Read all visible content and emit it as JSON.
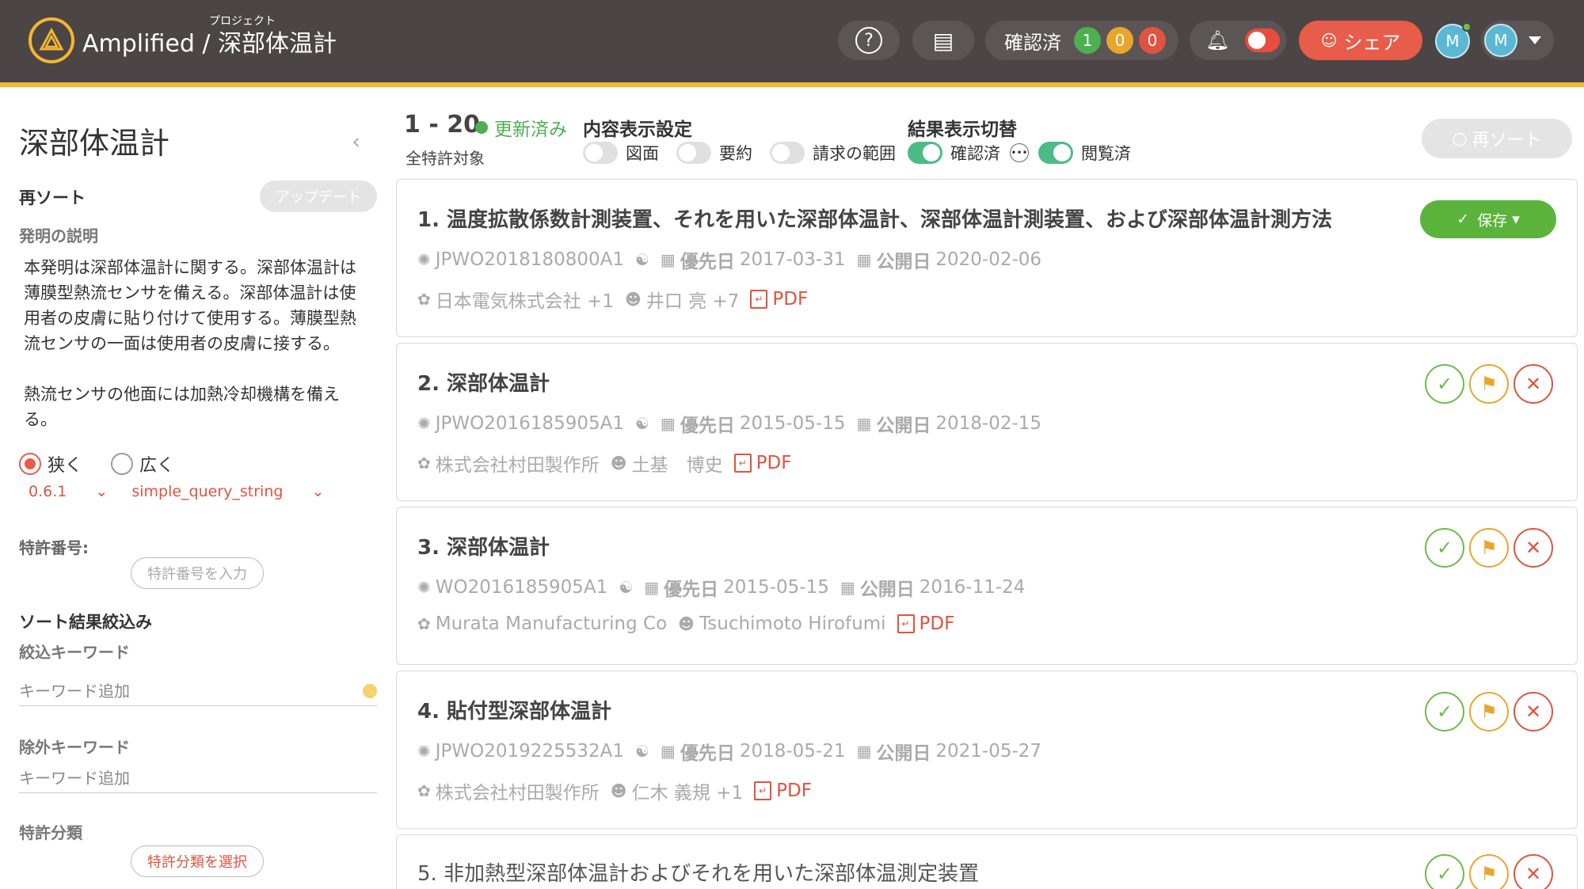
{
  "header": {
    "app_name": "Amplified",
    "separator": "/",
    "project_label": "プロジェクト",
    "project_name": "深部体温計",
    "help_icon": "?",
    "confirm_label": "確認済",
    "badges": [
      {
        "value": "1",
        "color": "#4caf50"
      },
      {
        "value": "0",
        "color": "#e8a62c"
      },
      {
        "value": "0",
        "color": "#e05340"
      }
    ],
    "share_label": "シェア",
    "avatar_letter": "M"
  },
  "sidebar": {
    "title": "深部体温計",
    "resort_label": "再ソート",
    "update_button": "アップデート",
    "description_label": "発明の説明",
    "description_p1": "本発明は深部体温計に関する。深部体温計は薄膜型熱流センサを備える。深部体温計は使用者の皮膚に貼り付けて使用する。薄膜型熱流センサの一面は使用者の皮膚に接する。",
    "description_p2": "熱流センサの他面には加熱冷却機構を備える。",
    "radio_narrow": "狭く",
    "radio_wide": "広く",
    "version": "0.6.1",
    "query_type": "simple_query_string",
    "patent_number_label": "特許番号:",
    "patent_number_button": "特許番号を入力",
    "filter_label": "ソート結果絞込み",
    "filter_keyword_label": "絞込キーワード",
    "filter_keyword_placeholder": "キーワード追加",
    "exclude_keyword_label": "除外キーワード",
    "exclude_keyword_placeholder": "キーワード追加",
    "classification_label": "特許分類",
    "classification_button": "特許分類を選択"
  },
  "main": {
    "range": "1 - 20",
    "updated_label": "更新済み",
    "scope": "全特許対象",
    "content_display_label": "内容表示設定",
    "toggles": [
      {
        "label": "図面",
        "on": false
      },
      {
        "label": "要約",
        "on": false
      },
      {
        "label": "請求の範囲",
        "on": false
      }
    ],
    "result_toggle_label": "結果表示切替",
    "result_toggles": [
      {
        "label": "確認済",
        "on": true
      },
      {
        "label": "閲覧済",
        "on": true
      }
    ],
    "resort_button": "再ソート",
    "save_button": "保存",
    "results": [
      {
        "title": "1. 温度拡散係数計測装置、それを用いた深部体温計、深部体温計測装置、および深部体温計測方法",
        "number": "JPWO2018180800A1",
        "priority_label": "優先日",
        "priority_date": "2017-03-31",
        "publication_label": "公開日",
        "publication_date": "2020-02-06",
        "applicant": "日本電気株式会社 +1",
        "inventor": "井口 亮 +7",
        "pdf": "PDF"
      },
      {
        "title": "2. 深部体温計",
        "number": "JPWO2016185905A1",
        "priority_label": "優先日",
        "priority_date": "2015-05-15",
        "publication_label": "公開日",
        "publication_date": "2018-02-15",
        "applicant": "株式会社村田製作所",
        "inventor": "土基　博史",
        "pdf": "PDF"
      },
      {
        "title": "3. 深部体温計",
        "number": "WO2016185905A1",
        "priority_label": "優先日",
        "priority_date": "2015-05-15",
        "publication_label": "公開日",
        "publication_date": "2016-11-24",
        "applicant": "Murata Manufacturing Co",
        "inventor": "Tsuchimoto Hirofumi",
        "pdf": "PDF"
      },
      {
        "title": "4. 貼付型深部体温計",
        "number": "JPWO2019225532A1",
        "priority_label": "優先日",
        "priority_date": "2018-05-21",
        "publication_label": "公開日",
        "publication_date": "2021-05-27",
        "applicant": "株式会社村田製作所",
        "inventor": "仁木 義規 +1",
        "pdf": "PDF"
      },
      {
        "title": "5. 非加熱型深部体温計およびそれを用いた深部体温測定装置"
      }
    ]
  }
}
